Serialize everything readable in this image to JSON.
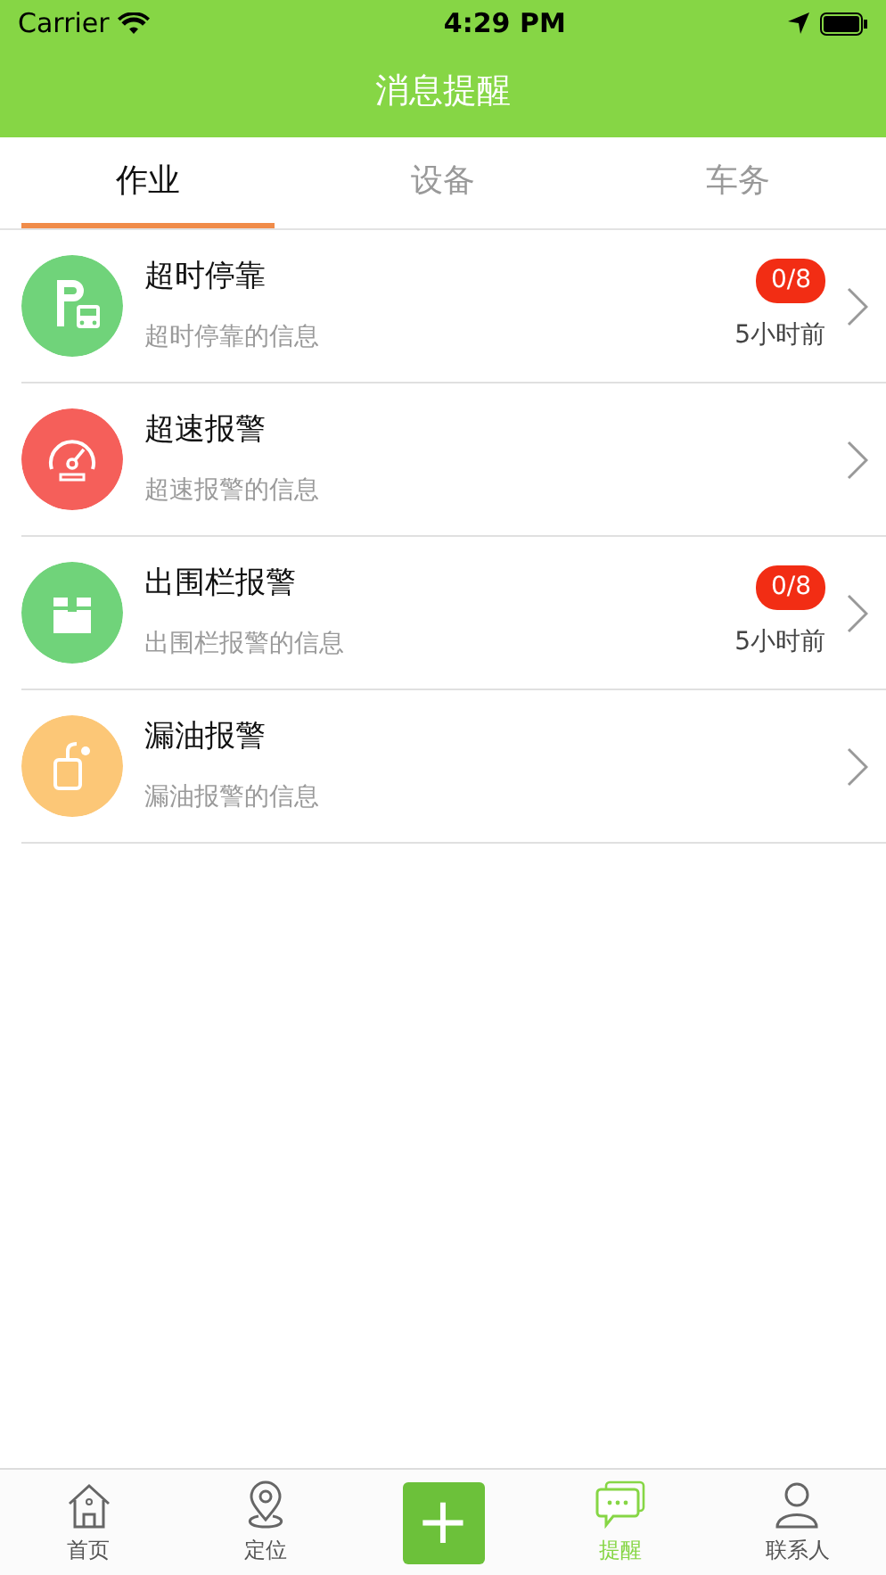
{
  "status_bar": {
    "carrier": "Carrier",
    "time": "4:29 PM"
  },
  "header": {
    "title": "消息提醒"
  },
  "tabs": [
    {
      "label": "作业",
      "selected": true
    },
    {
      "label": "设备",
      "selected": false
    },
    {
      "label": "车务",
      "selected": false
    }
  ],
  "messages": [
    {
      "kind": "parking",
      "color": "#70d37a",
      "title": "超时停靠",
      "subtitle": "超时停靠的信息",
      "badge": "0/8",
      "time": "5小时前"
    },
    {
      "kind": "gauge",
      "color": "#f55f5a",
      "title": "超速报警",
      "subtitle": "超速报警的信息"
    },
    {
      "kind": "box",
      "color": "#70d37a",
      "title": "出围栏报警",
      "subtitle": "出围栏报警的信息",
      "badge": "0/8",
      "time": "5小时前"
    },
    {
      "kind": "oil",
      "color": "#fcc777",
      "title": "漏油报警",
      "subtitle": "漏油报警的信息"
    }
  ],
  "tab_bar": [
    {
      "kind": "home",
      "label": "首页",
      "selected": false
    },
    {
      "kind": "pin",
      "label": "定位",
      "selected": false
    },
    {
      "kind": "add",
      "label": "+",
      "selected": false
    },
    {
      "kind": "chat",
      "label": "提醒",
      "selected": true
    },
    {
      "kind": "person",
      "label": "联系人",
      "selected": false
    }
  ]
}
